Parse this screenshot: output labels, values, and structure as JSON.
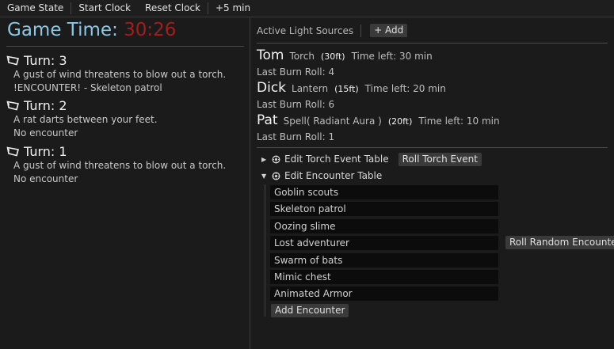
{
  "menu": {
    "game_state": "Game State",
    "start_clock": "Start Clock",
    "reset_clock": "Reset Clock",
    "plus_five": "+5 min"
  },
  "game_time": {
    "label": "Game Time:",
    "value": "30:26"
  },
  "turns": [
    {
      "title": "Turn: 3",
      "lines": [
        "A gust of wind threatens to blow out a torch.",
        "!ENCOUNTER! - Skeleton patrol"
      ]
    },
    {
      "title": "Turn: 2",
      "lines": [
        "A rat darts between your feet.",
        "No encounter"
      ]
    },
    {
      "title": "Turn: 1",
      "lines": [
        "A gust of wind threatens to blow out a torch.",
        "No encounter"
      ]
    }
  ],
  "light_sources": {
    "title": "Active Light Sources",
    "add_label": "+ Add",
    "items": [
      {
        "name": "Tom",
        "type": "Torch",
        "range": "(30ft)",
        "time": "Time left: 30 min",
        "roll": "Last Burn Roll: 4"
      },
      {
        "name": "Dick",
        "type": "Lantern",
        "range": "(15ft)",
        "time": "Time left: 20 min",
        "roll": "Last Burn Roll: 6"
      },
      {
        "name": "Pat",
        "type": "Spell( Radiant Aura )",
        "range": "(20ft)",
        "time": "Time left: 10 min",
        "roll": "Last Burn Roll: 1"
      }
    ]
  },
  "torch_table": {
    "label": "Edit Torch Event Table",
    "button": "Roll Torch Event",
    "expanded": false
  },
  "encounter_table": {
    "label": "Edit Encounter Table",
    "expanded": true,
    "roll_button": "Roll Random Encounter",
    "add_button": "Add Encounter",
    "entries": [
      "Goblin scouts",
      "Skeleton patrol",
      "Oozing slime",
      "Lost adventurer",
      "Swarm of bats",
      "Mimic chest",
      "Animated Armor"
    ]
  },
  "colors": {
    "accent_time_label": "#8cc8e6",
    "clock_red": "#a61c1c",
    "background": "#1b1b1b"
  },
  "icons": {
    "turn": "flag-icon",
    "table": "gear-icon",
    "collapsed": "triangle-right-icon",
    "expanded": "triangle-down-icon"
  }
}
